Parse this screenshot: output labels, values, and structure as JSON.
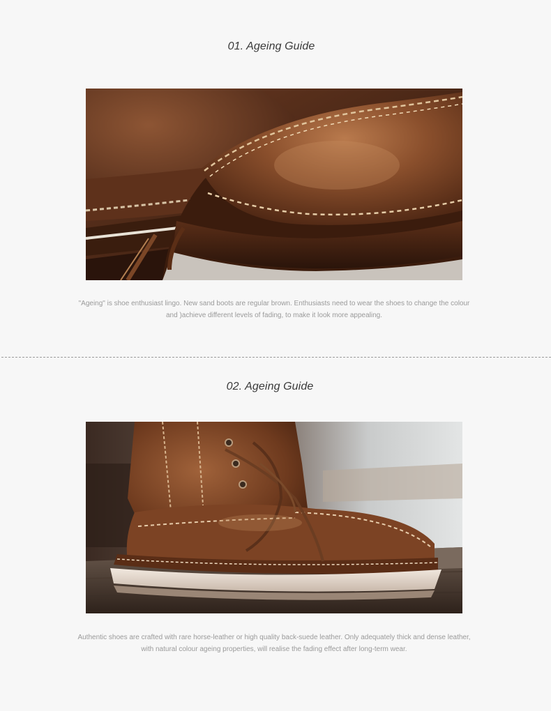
{
  "sections": [
    {
      "heading": "01. Ageing Guide",
      "image": "close-up of worn brown leather moc-toe boot",
      "caption": "\"Ageing\" is shoe enthusiast lingo. New sand boots are regular brown. Enthusiasts need to wear the shoes to change the colour and )achieve different levels of fading, to make it look more appealing."
    },
    {
      "heading": "02. Ageing Guide",
      "image": "brown leather lace-up work boot with white wedge sole on wooden surface",
      "caption": "Authentic shoes are crafted with rare horse-leather or high quality back-suede leather. Only adequately thick and dense leather, with natural colour ageing properties, will realise the fading effect after long-term wear."
    }
  ],
  "colors": {
    "background": "#f7f7f7",
    "heading": "#3a3a3a",
    "caption": "#9a9a9a",
    "divider": "#9a9a9a"
  }
}
